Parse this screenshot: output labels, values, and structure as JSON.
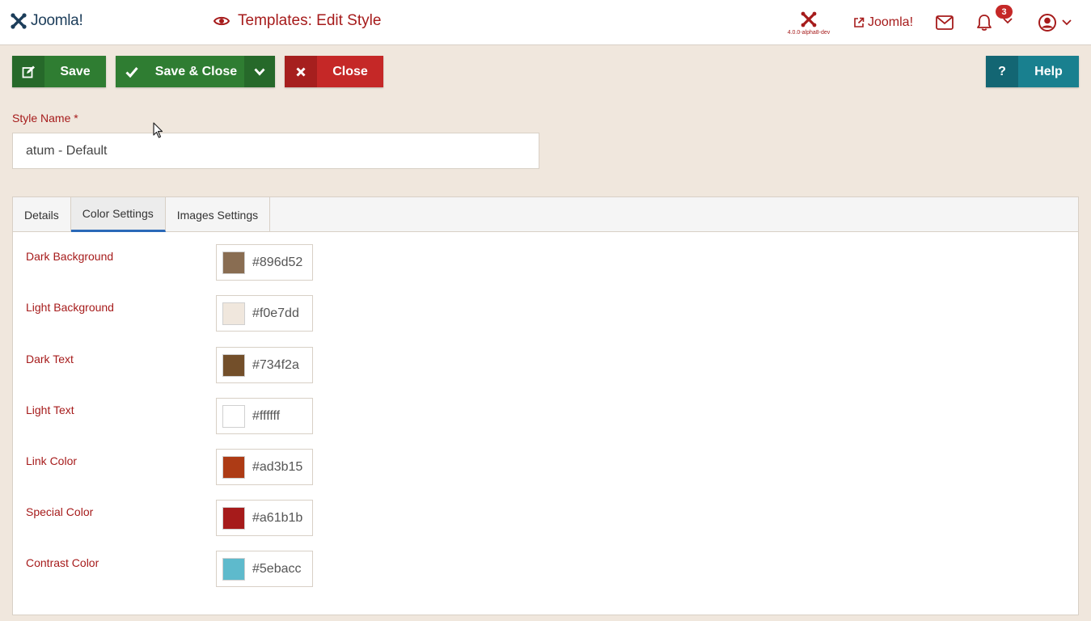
{
  "header": {
    "logo_text": "Joomla!",
    "title": "Templates: Edit Style",
    "version": "4.0.0-alpha8-dev",
    "site_link": "Joomla!",
    "notification_count": "3"
  },
  "toolbar": {
    "save_label": "Save",
    "save_close_label": "Save & Close",
    "close_label": "Close",
    "help_label": "Help",
    "help_icon_glyph": "?"
  },
  "style_name": {
    "label": "Style Name *",
    "value": "atum - Default"
  },
  "tabs": [
    {
      "label": "Details"
    },
    {
      "label": "Color Settings"
    },
    {
      "label": "Images Settings"
    }
  ],
  "colors": [
    {
      "label": "Dark Background",
      "value": "#896d52",
      "swatch": "#896d52"
    },
    {
      "label": "Light Background",
      "value": "#f0e7dd",
      "swatch": "#f0e7dd"
    },
    {
      "label": "Dark Text",
      "value": "#734f2a",
      "swatch": "#734f2a"
    },
    {
      "label": "Light Text",
      "value": "#ffffff",
      "swatch": "#ffffff"
    },
    {
      "label": "Link Color",
      "value": "#ad3b15",
      "swatch": "#ad3b15"
    },
    {
      "label": "Special Color",
      "value": "#a61b1b",
      "swatch": "#a61b1b"
    },
    {
      "label": "Contrast Color",
      "value": "#5ebacc",
      "swatch": "#5ebacc"
    }
  ],
  "theme": {
    "accent": "#a61b1b",
    "success": "#2f7d32",
    "danger": "#c52827",
    "info": "#19808f",
    "background": "#f0e7dd"
  }
}
